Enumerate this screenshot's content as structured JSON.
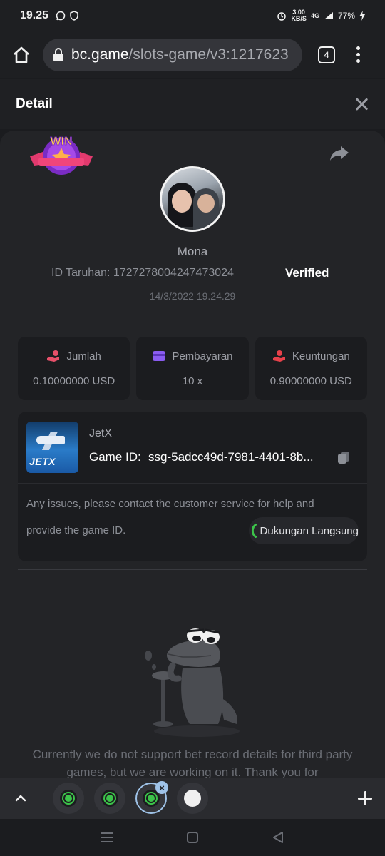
{
  "status_bar": {
    "time": "19.25",
    "speed_value": "3.00",
    "speed_unit": "KB/S",
    "network": "4G",
    "battery": "77%"
  },
  "browser": {
    "url_host": "bc.game",
    "url_path": "/slots-game/v3:1217623",
    "tab_count": "4"
  },
  "header": {
    "title": "Detail"
  },
  "bet": {
    "win_badge_text": "WIN",
    "username": "Mona",
    "bet_id": "ID Taruhan: 1727278004247473024",
    "verified_label": "Verified",
    "datetime": "14/3/2022 19.24.29"
  },
  "stats": [
    {
      "label": "Jumlah",
      "value": "0.10000000 USD",
      "icon": "coin-hand-icon",
      "color": "#e8506a"
    },
    {
      "label": "Pembayaran",
      "value": "10 x",
      "icon": "card-icon",
      "color": "#8a5cf0"
    },
    {
      "label": "Keuntungan",
      "value": "0.90000000 USD",
      "icon": "profit-hand-icon",
      "color": "#e8414a"
    }
  ],
  "game": {
    "thumb_logo": "JETX",
    "name": "JetX",
    "id_label": "Game ID:",
    "id_value": "ssg-5adcc49d-7981-4401-8b...",
    "issue_line1": "Any issues, please contact the customer service for help and",
    "issue_line2": "provide the game ID.",
    "support_label": "Dukungan Langsung"
  },
  "empty_state": {
    "message": "Currently we do not support bet record details for third party games, but we are working on it. Thank you for"
  },
  "colors": {
    "accent_green": "#3cc44a",
    "background": "#1b1c1f",
    "panel": "#232427"
  }
}
